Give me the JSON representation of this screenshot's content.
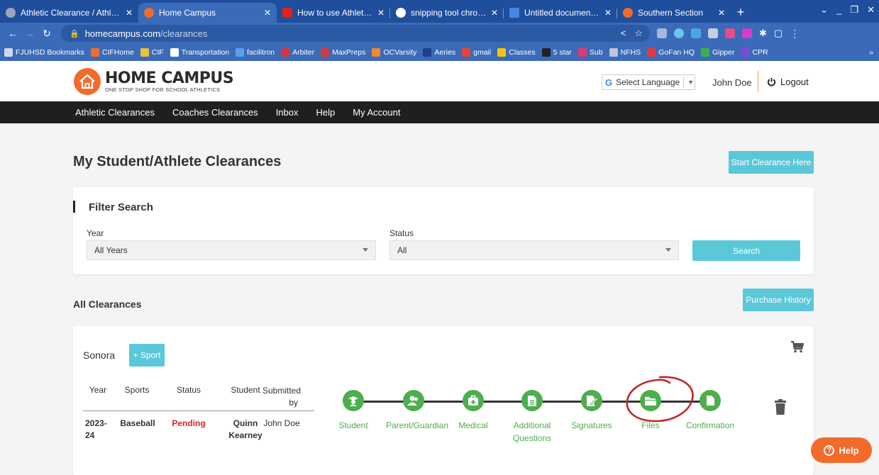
{
  "browser": {
    "tabs": [
      {
        "title": "Athletic Clearance / Athletic I",
        "color": "#9aa6bd"
      },
      {
        "title": "Home Campus",
        "color": "#f26b2a"
      },
      {
        "title": "How to use Athletic Clearanc",
        "color": "#e62117"
      },
      {
        "title": "snipping tool chromebook - C",
        "color": "#ffffff"
      },
      {
        "title": "Untitled document - Google D",
        "color": "#4a86e8"
      },
      {
        "title": "Southern Section",
        "color": "#f26b2a"
      }
    ],
    "url_host": "homecampus.com",
    "url_path": "/clearances",
    "bookmarks": [
      {
        "label": "FJUHSD Bookmarks",
        "color": "#cfd8e8"
      },
      {
        "label": "CIFHome",
        "color": "#f26b2a"
      },
      {
        "label": "CIF",
        "color": "#e8c23a"
      },
      {
        "label": "Transportation",
        "color": "#ffffff"
      },
      {
        "label": "facilitron",
        "color": "#5aa0e6"
      },
      {
        "label": "Arbiter",
        "color": "#d23a3a"
      },
      {
        "label": "MaxPreps",
        "color": "#d23a3a"
      },
      {
        "label": "OCVarsity",
        "color": "#f08a2a"
      },
      {
        "label": "Aeries",
        "color": "#1f3e8c"
      },
      {
        "label": "gmail",
        "color": "#ea4335"
      },
      {
        "label": "Classes",
        "color": "#f5c518"
      },
      {
        "label": "5 star",
        "color": "#222222"
      },
      {
        "label": "Sub",
        "color": "#e23a6a"
      },
      {
        "label": "NFHS",
        "color": "#c0c6d2"
      },
      {
        "label": "GoFan HQ",
        "color": "#e23a3a"
      },
      {
        "label": "Gipper",
        "color": "#3cb04a"
      },
      {
        "label": "CPR",
        "color": "#7a4ad8"
      }
    ],
    "bookmarks_more": "»"
  },
  "header": {
    "logo_title": "HOME CAMPUS",
    "logo_tagline": "ONE STOP SHOP FOR SCHOOL ATHLETICS",
    "language_label": "Select Language",
    "user_name": "John Doe",
    "logout_label": "Logout"
  },
  "nav": {
    "items": [
      "Athletic Clearances",
      "Coaches Clearances",
      "Inbox",
      "Help",
      "My Account"
    ]
  },
  "page": {
    "title": "My Student/Athlete Clearances",
    "start_button": "Start Clearance Here"
  },
  "filter": {
    "title": "Filter Search",
    "year_label": "Year",
    "year_value": "All Years",
    "status_label": "Status",
    "status_value": "All",
    "search_button": "Search"
  },
  "clearances": {
    "title": "All Clearances",
    "purchase_button": "Purchase History",
    "school": "Sonora",
    "add_sport_button": "+ Sport",
    "columns": [
      "Year",
      "Sports",
      "Status",
      "Student",
      "Submitted by"
    ],
    "row": {
      "year": "2023-24",
      "sport": "Baseball",
      "status": "Pending",
      "student": "Quinn Kearney",
      "submitted_by": "John Doe"
    },
    "steps": [
      "Student",
      "Parent/Guardian",
      "Medical",
      "Additional Questions",
      "Signatures",
      "Files",
      "Confirmation"
    ],
    "status_color": "#e02020",
    "step_color": "#4cae4c"
  },
  "help_button": "Help",
  "colors": {
    "brand_orange": "#f26b2a",
    "teal_button": "#5bc8da",
    "nav_bg": "#1d1f21",
    "annotation_red": "#c0282a"
  }
}
